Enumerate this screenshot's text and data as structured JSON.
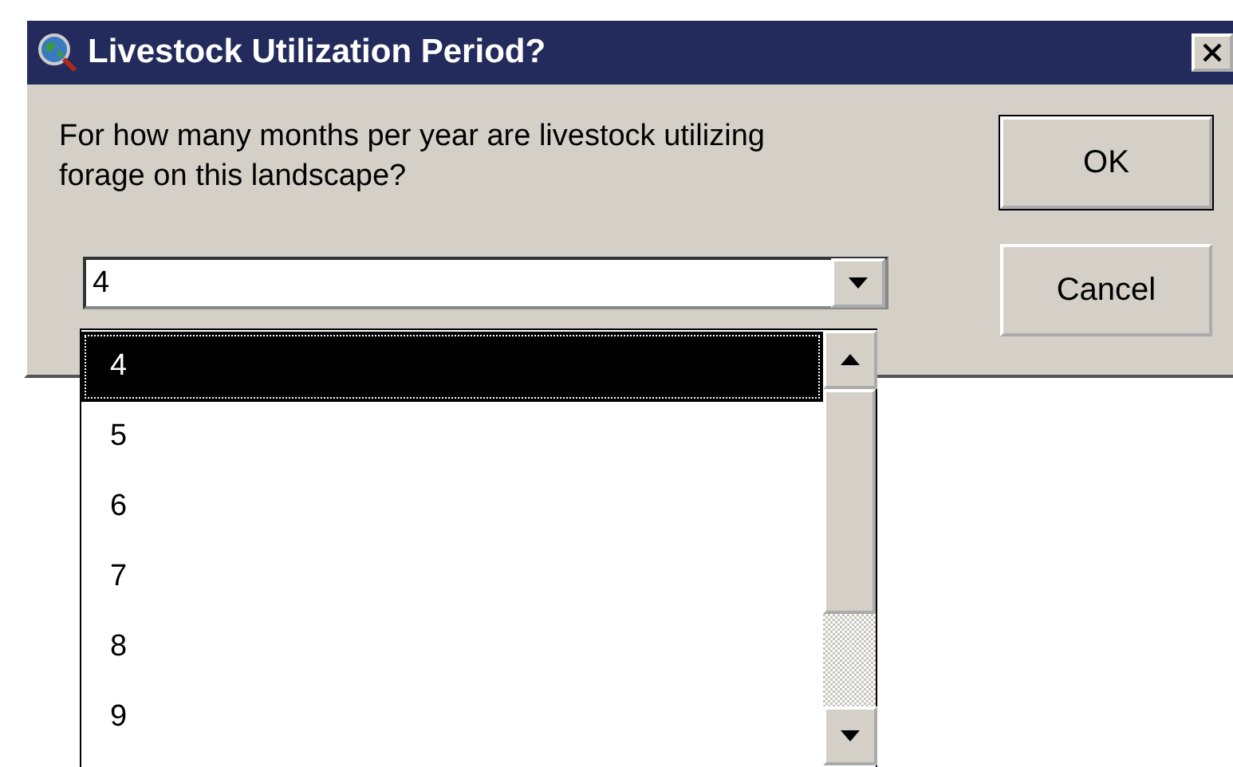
{
  "window": {
    "title": "Livestock Utilization Period?"
  },
  "prompt": "For how many months per year are livestock utilizing forage on this landscape?",
  "combo": {
    "value": "4"
  },
  "options": [
    {
      "label": "4",
      "selected": true
    },
    {
      "label": "5",
      "selected": false
    },
    {
      "label": "6",
      "selected": false
    },
    {
      "label": "7",
      "selected": false
    },
    {
      "label": "8",
      "selected": false
    },
    {
      "label": "9",
      "selected": false
    }
  ],
  "buttons": [
    "OK",
    "Cancel"
  ]
}
